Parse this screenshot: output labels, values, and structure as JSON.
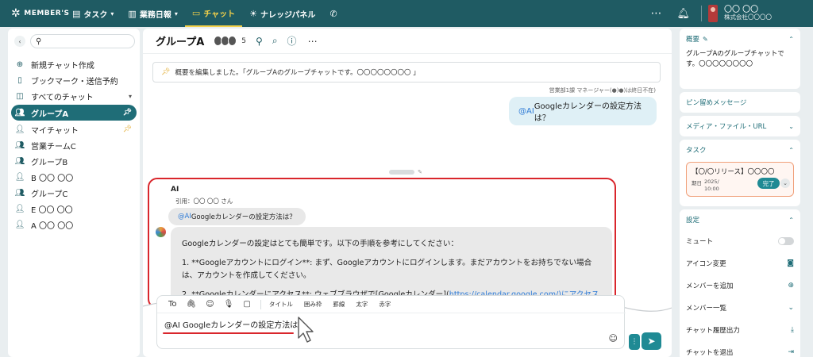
{
  "topbar": {
    "logo_text": "MEMBER'S",
    "nav": [
      {
        "label": "タスク",
        "icon": "document-icon",
        "has_chevron": true
      },
      {
        "label": "業務日報",
        "icon": "clipboard-icon",
        "has_chevron": true
      },
      {
        "label": "チャット",
        "icon": "chat-icon",
        "active": true
      },
      {
        "label": "ナレッジパネル",
        "icon": "lightbulb-icon"
      },
      {
        "label": "",
        "icon": "phone-icon"
      }
    ],
    "user_name": "〇〇 〇〇",
    "user_company": "株式会社〇〇〇〇"
  },
  "sidebar": {
    "search_value": "",
    "items": [
      {
        "label": "新規チャット作成",
        "icon": "plus-circle-icon"
      },
      {
        "label": "ブックマーク・送信予約",
        "icon": "bookmark-icon"
      },
      {
        "label": "すべてのチャット",
        "icon": "chat-bubbles-icon",
        "has_chevron": true
      },
      {
        "label": "グループA",
        "icon": "group-icon",
        "active": true,
        "pinned": true
      },
      {
        "label": "マイチャット",
        "icon": "person-icon",
        "pinned": true
      },
      {
        "label": "営業チームC",
        "icon": "group-icon"
      },
      {
        "label": "グループB",
        "icon": "group-icon"
      },
      {
        "label": "B 〇〇 〇〇",
        "icon": "avatar-icon"
      },
      {
        "label": "グループC",
        "icon": "group-icon"
      },
      {
        "label": "E 〇〇 〇〇",
        "icon": "avatar-icon"
      },
      {
        "label": "A 〇〇 〇〇",
        "icon": "avatar-icon"
      }
    ]
  },
  "chat": {
    "title": "グループA",
    "member_count": "5",
    "notice": "概要を編集しました。「グループAのグループチャットです。〇〇〇〇〇〇〇〇 」",
    "my_message": {
      "meta": "営業部1課 マネージャー(●)●)は終日不在)",
      "mention": "@AI",
      "text": " Googleカレンダーの設定方法は？"
    },
    "ai_message": {
      "sender": "AI",
      "quote_label": "引用：〇〇 〇〇 さん",
      "quote_mention": "@AI",
      "quote_text": " Googleカレンダーの設定方法は？",
      "para1": "Googleカレンダーの設定はとても簡単です。以下の手順を参考にしてください：",
      "para2": "1. **Googleアカウントにログイン**: まず、Googleアカウントにログインします。まだアカウントをお持ちでない場合は、アカウントを作成してください。",
      "para3_text": "2. **Googleカレンダーにアクセス**: ウェブブラウザで[Googleカレンダー](",
      "para3_link": "https://calendar.google.com/",
      "para3_tail": ")にアクセスします。"
    }
  },
  "composer": {
    "toolbar": {
      "to": "To",
      "buttons": [
        "タイトル",
        "囲み枠",
        "罫線",
        "太字",
        "赤字"
      ]
    },
    "input_value": "@AI Googleカレンダーの設定方法は？"
  },
  "right_panel": {
    "overview_title": "概要",
    "overview_text": "グループAのグループチャットです。〇〇〇〇〇〇〇〇",
    "pinned_title": "ピン留めメッセージ",
    "media_title": "メディア・ファイル・URL",
    "task_title": "タスク",
    "task": {
      "name": "【〇/〇リリース】〇〇〇〇",
      "due_label": "期日",
      "due_value": "2025/",
      "due_time": "10:00",
      "status": "完了"
    },
    "settings_title": "設定",
    "settings": [
      {
        "label": "ミュート",
        "icon": "toggle"
      },
      {
        "label": "アイコン変更",
        "icon": "camera-icon"
      },
      {
        "label": "メンバーを追加",
        "icon": "plus-circle-icon"
      },
      {
        "label": "メンバー一覧",
        "icon": "chevron-down-icon"
      },
      {
        "label": "チャット履歴出力",
        "icon": "download-icon"
      },
      {
        "label": "チャットを退出",
        "icon": "exit-icon"
      }
    ]
  },
  "colors": {
    "header_bg": "#1f5b63",
    "accent": "#1f8a94",
    "active_nav": "#f3d14a",
    "highlight_red": "#d9262c",
    "mention": "#2f7bd6"
  }
}
